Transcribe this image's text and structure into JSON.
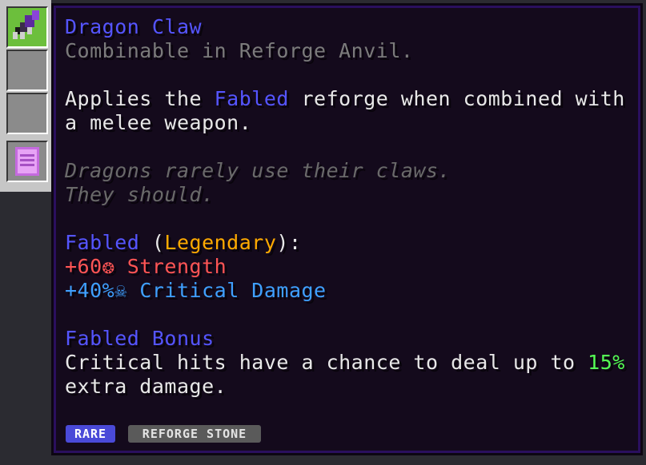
{
  "inventory": {
    "slots": [
      {
        "item": "dragon-claw-icon",
        "highlight": true
      },
      {
        "item": "",
        "highlight": false
      },
      {
        "item": "",
        "highlight": false
      },
      {
        "item": "enchanted-book-icon",
        "highlight": false
      }
    ]
  },
  "tooltip": {
    "name": "Dragon Claw",
    "subtitle": "Combinable in Reforge Anvil.",
    "desc_line1_pre": "Applies the ",
    "desc_line1_hl": "Fabled",
    "desc_line1_post": " reforge when combined with",
    "desc_line2": "a melee weapon.",
    "lore_line1": "Dragons rarely use their claws.",
    "lore_line2": "They should.",
    "reforge_name": "Fabled",
    "reforge_open": " (",
    "reforge_rarity": "Legendary",
    "reforge_close": "):",
    "stat1_value": "+60",
    "stat1_icon": "❂",
    "stat1_name": " Strength",
    "stat2_value": "+40%",
    "stat2_icon": "☠",
    "stat2_name": " Critical Damage",
    "bonus_title": "Fabled Bonus",
    "bonus_line1_pre": "Critical hits have a chance to deal up to ",
    "bonus_line1_hl": "15%",
    "bonus_line2": "extra damage.",
    "rarity_badge": "RARE",
    "type_badge": "REFORGE STONE"
  },
  "colors": {
    "rare": "#5555ff",
    "legendary": "#ffaa00",
    "strength": "#ff5555",
    "crit_damage": "#3fa0ff",
    "highlight": "#55ff55"
  }
}
